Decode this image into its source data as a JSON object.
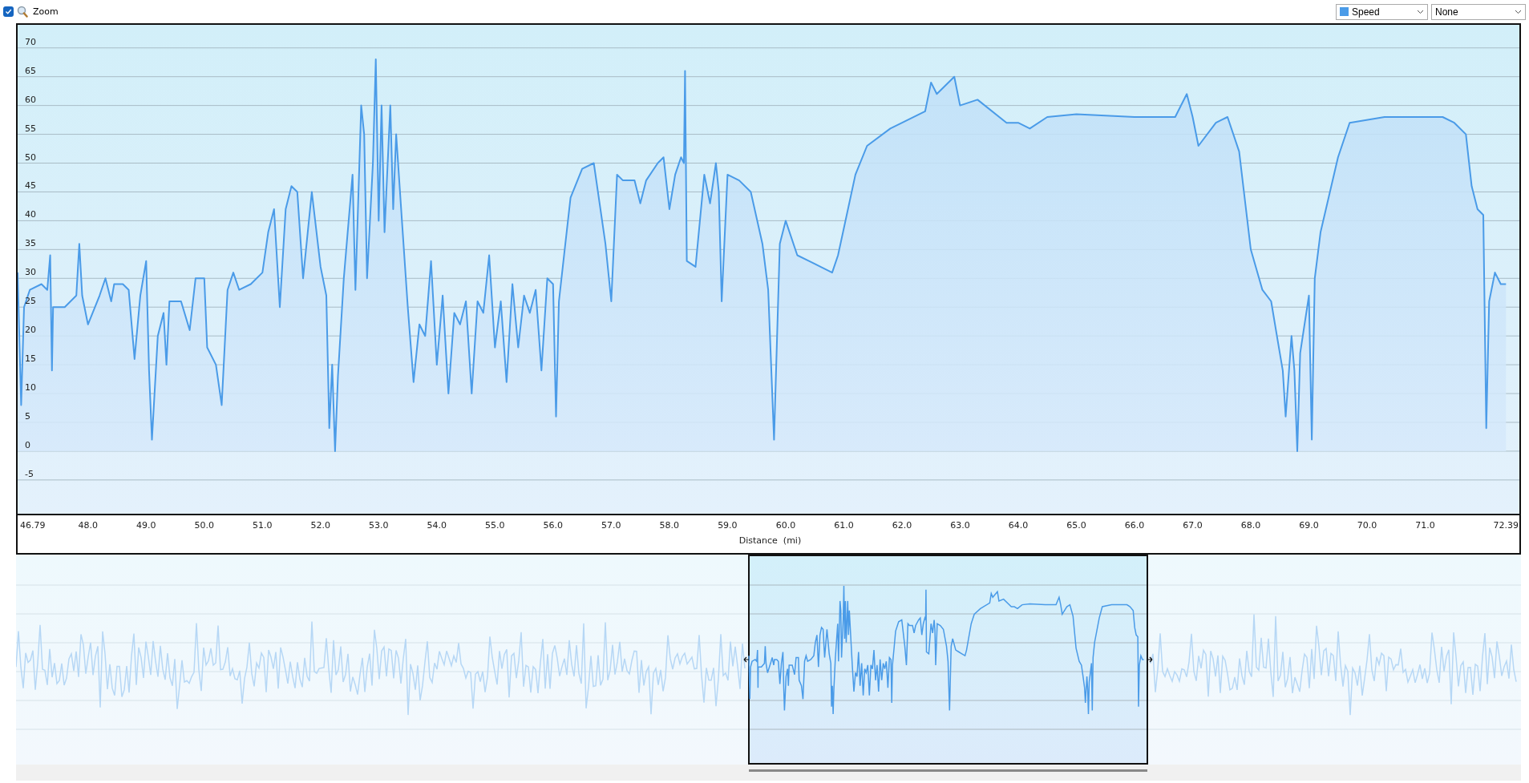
{
  "toolbar": {
    "zoom": {
      "label": "Zoom",
      "checked": true
    },
    "dropdowns": [
      {
        "kind": "series"
      },
      {
        "value": "None",
        "kind": "plain"
      }
    ]
  },
  "chart": {
    "chart_data": {
      "type": "area",
      "grid": true,
      "xlabel": "Distance  (mi)",
      "xlim": [
        46.79,
        72.62
      ],
      "ylim": [
        -11,
        74
      ],
      "xticks": [
        {
          "value": 46.79,
          "label": "46.79"
        },
        {
          "value": 48,
          "label": "48.0"
        },
        {
          "value": 49,
          "label": "49.0"
        },
        {
          "value": 50,
          "label": "50.0"
        },
        {
          "value": 51,
          "label": "51.0"
        },
        {
          "value": 52,
          "label": "52.0"
        },
        {
          "value": 53,
          "label": "53.0"
        },
        {
          "value": 54,
          "label": "54.0"
        },
        {
          "value": 55,
          "label": "55.0"
        },
        {
          "value": 56,
          "label": "56.0"
        },
        {
          "value": 57,
          "label": "57.0"
        },
        {
          "value": 58,
          "label": "58.0"
        },
        {
          "value": 59,
          "label": "59.0"
        },
        {
          "value": 60,
          "label": "60.0"
        },
        {
          "value": 61,
          "label": "61.0"
        },
        {
          "value": 62,
          "label": "62.0"
        },
        {
          "value": 63,
          "label": "63.0"
        },
        {
          "value": 64,
          "label": "64.0"
        },
        {
          "value": 65,
          "label": "65.0"
        },
        {
          "value": 66,
          "label": "66.0"
        },
        {
          "value": 67,
          "label": "67.0"
        },
        {
          "value": 68,
          "label": "68.0"
        },
        {
          "value": 69,
          "label": "69.0"
        },
        {
          "value": 70,
          "label": "70.0"
        },
        {
          "value": 71,
          "label": "71.0"
        },
        {
          "value": 72.39,
          "label": "72.39"
        }
      ],
      "yticks": [
        -5,
        0,
        5,
        10,
        15,
        20,
        25,
        30,
        35,
        40,
        45,
        50,
        55,
        60,
        65,
        70
      ],
      "x": [
        46.79,
        46.85,
        46.9,
        47.0,
        47.2,
        47.3,
        47.35,
        47.38,
        47.4,
        47.6,
        47.8,
        47.85,
        47.9,
        48.0,
        48.2,
        48.3,
        48.4,
        48.45,
        48.6,
        48.7,
        48.8,
        48.9,
        49.0,
        49.05,
        49.1,
        49.2,
        49.3,
        49.35,
        49.4,
        49.6,
        49.75,
        49.85,
        50.0,
        50.05,
        50.2,
        50.3,
        50.4,
        50.5,
        50.6,
        50.8,
        51.0,
        51.1,
        51.2,
        51.3,
        51.4,
        51.5,
        51.6,
        51.7,
        51.85,
        52.0,
        52.1,
        52.15,
        52.2,
        52.25,
        52.3,
        52.4,
        52.55,
        52.6,
        52.7,
        52.75,
        52.8,
        52.9,
        52.95,
        53.0,
        53.05,
        53.1,
        53.2,
        53.25,
        53.3,
        53.4,
        53.5,
        53.6,
        53.7,
        53.8,
        53.9,
        54.0,
        54.1,
        54.2,
        54.3,
        54.4,
        54.5,
        54.6,
        54.7,
        54.8,
        54.9,
        55.0,
        55.1,
        55.2,
        55.3,
        55.4,
        55.5,
        55.6,
        55.7,
        55.8,
        55.9,
        56.0,
        56.05,
        56.1,
        56.2,
        56.3,
        56.5,
        56.7,
        56.9,
        57.0,
        57.1,
        57.2,
        57.4,
        57.5,
        57.6,
        57.8,
        57.9,
        58.0,
        58.1,
        58.2,
        58.25,
        58.27,
        58.3,
        58.45,
        58.6,
        58.7,
        58.8,
        58.85,
        58.9,
        59.0,
        59.2,
        59.4,
        59.6,
        59.7,
        59.8,
        59.9,
        60.0,
        60.2,
        60.4,
        60.6,
        60.8,
        60.9,
        61.2,
        61.4,
        61.8,
        62.4,
        62.5,
        62.6,
        62.9,
        63.0,
        63.3,
        63.8,
        64.0,
        64.2,
        64.5,
        65.0,
        66.0,
        66.7,
        66.9,
        67.0,
        67.1,
        67.4,
        67.6,
        67.8,
        68.0,
        68.2,
        68.35,
        68.45,
        68.55,
        68.6,
        68.7,
        68.75,
        68.8,
        68.85,
        69.0,
        69.05,
        69.1,
        69.2,
        69.5,
        69.7,
        70.3,
        70.8,
        71.3,
        71.5,
        71.7,
        71.8,
        71.9,
        72.0,
        72.05,
        72.1,
        72.2,
        72.3,
        72.39
      ],
      "series": [
        {
          "name": "Speed",
          "color": "#4a9be8",
          "values": [
            31,
            8,
            25,
            28,
            29,
            28,
            34,
            14,
            25,
            25,
            27,
            36,
            27,
            22,
            27,
            30,
            26,
            29,
            29,
            28,
            16,
            27,
            33,
            14,
            2,
            20,
            24,
            15,
            26,
            26,
            21,
            30,
            30,
            18,
            15,
            8,
            28,
            31,
            28,
            29,
            31,
            38,
            42,
            25,
            42,
            46,
            45,
            30,
            45,
            32,
            27,
            4,
            15,
            0,
            13,
            30,
            48,
            28,
            60,
            55,
            30,
            50,
            68,
            40,
            60,
            38,
            60,
            42,
            55,
            40,
            25,
            12,
            22,
            20,
            33,
            15,
            27,
            10,
            24,
            22,
            26,
            10,
            26,
            24,
            34,
            18,
            26,
            12,
            29,
            18,
            27,
            24,
            28,
            14,
            30,
            29,
            6,
            26,
            35,
            44,
            49,
            50,
            36,
            26,
            48,
            47,
            47,
            43,
            47,
            50,
            51,
            42,
            48,
            51,
            50,
            66,
            33,
            32,
            48,
            43,
            50,
            45,
            26,
            48,
            47,
            45,
            36,
            28,
            2,
            36,
            40,
            34,
            33,
            32,
            31,
            34,
            48,
            53,
            56,
            59,
            64,
            62,
            65,
            60,
            61,
            57,
            57,
            56,
            58,
            58.5,
            58,
            58,
            62,
            58,
            53,
            57,
            58,
            52,
            35,
            28,
            26,
            20,
            14,
            6,
            20,
            14,
            0,
            17,
            27,
            2,
            30,
            38,
            51,
            57,
            58,
            58,
            58,
            57,
            55,
            46,
            42,
            41,
            4,
            26,
            31,
            29,
            29
          ]
        }
      ]
    }
  }
}
